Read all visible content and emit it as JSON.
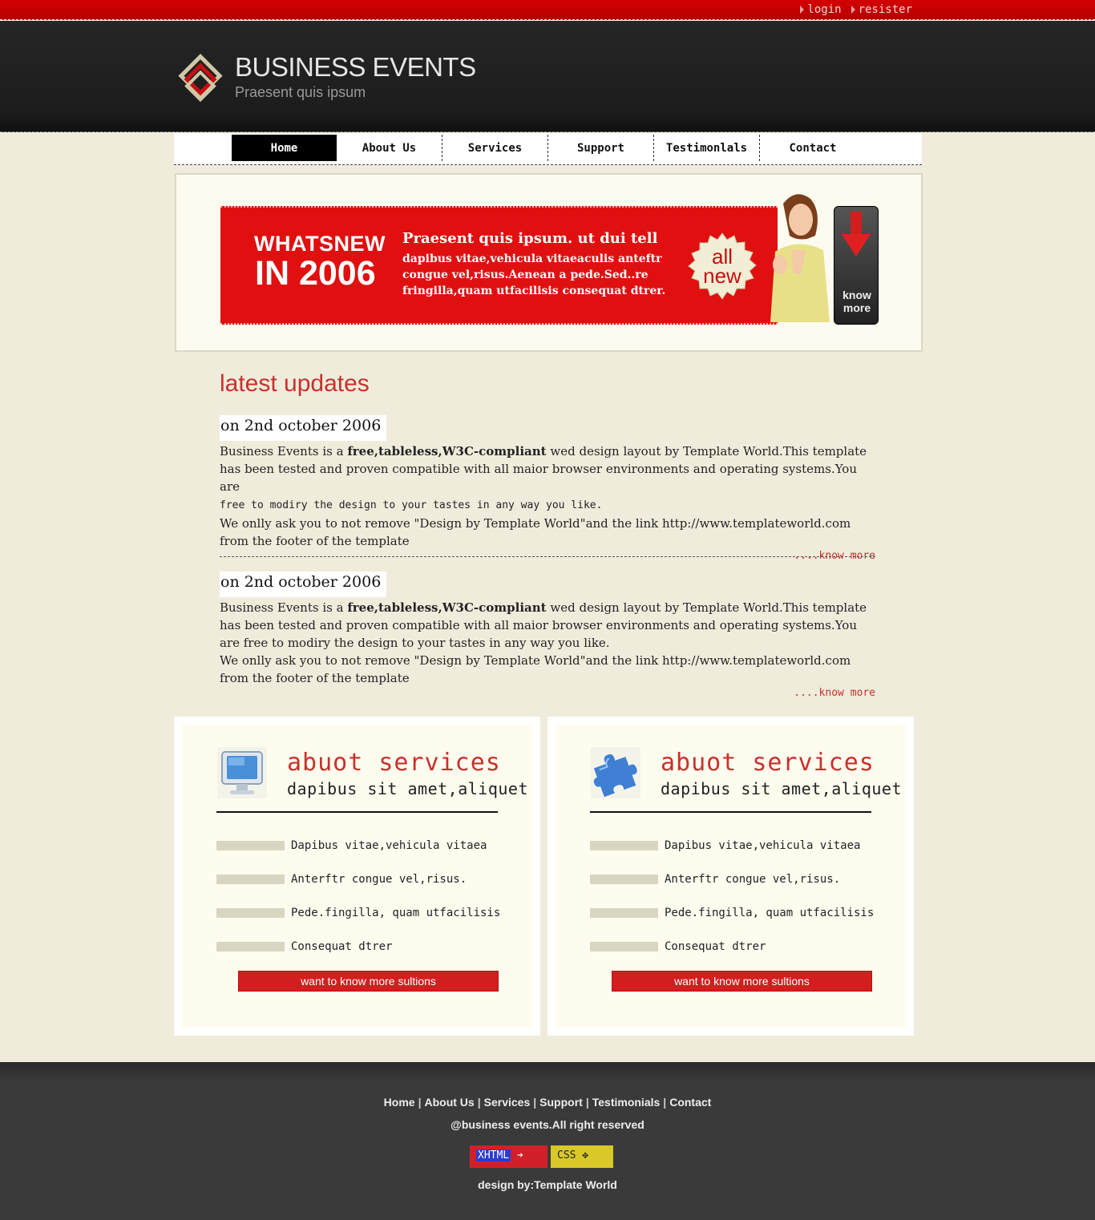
{
  "top_links": {
    "login": "login",
    "register": "resister"
  },
  "header": {
    "title": "BUSINESS EVENTS",
    "subtitle": "Praesent quis ipsum"
  },
  "nav": {
    "home": "Home",
    "about": "About Us",
    "services": "Services",
    "support": "Support",
    "testimonials": "Testimonlals",
    "contact": "Contact"
  },
  "banner": {
    "whatsnew": "WHATSNEW",
    "year": "IN 2006",
    "heading": "Praesent quis ipsum. ut dui tell",
    "text": "dapibus vitae,vehicula vitaeaculis anteftr congue vel,risus.Aenean a pede.Sed..re fringilla,quam utfacilisis consequat dtrer.",
    "badge_line1": "all",
    "badge_line2": "new",
    "know_more_line1": "know",
    "know_more_line2": "more"
  },
  "updates": {
    "title": "latest updates",
    "posts": [
      {
        "date": "on 2nd october 2006",
        "intro": "Business Events is a ",
        "bold": "free,tableless,W3C-compliant",
        "rest": " wed design layout by Template World.This template has been tested and proven compatible with all maior browser environments and operating systems.You are ",
        "rest2": "free to modiry the design to your tastes in any way you like.",
        "para2": "We onlly ask you to not remove \"Design by Template World\"and the link http://www.templateworld.com from the footer of the template",
        "more": "....know more"
      },
      {
        "date": "on 2nd october 2006",
        "intro": "Business Events is a ",
        "bold": "free,tableless,W3C-compliant",
        "rest": " wed design layout by Template World.This template has been tested and proven compatible with all maior browser environments and operating systems.You are free to modiry the design to your tastes in any way you like.",
        "para2": "We onlly ask you to not remove \"Design by Template World\"and the link http://www.templateworld.com from the footer of the template",
        "more": "....know more"
      }
    ]
  },
  "services": [
    {
      "icon": "computer-monitor-icon",
      "title": "abuot services",
      "subtitle": "dapibus sit amet,aliquet",
      "items": [
        "Dapibus vitae,vehicula vitaea",
        "Anterftr congue vel,risus.",
        "Pede.fingilla, quam utfacilisis",
        "Consequat dtrer"
      ],
      "button": "want to know more sultions"
    },
    {
      "icon": "puzzle-piece-icon",
      "title": "abuot services",
      "subtitle": "dapibus sit amet,aliquet",
      "items": [
        "Dapibus vitae,vehicula vitaea",
        "Anterftr congue vel,risus.",
        "Pede.fingilla, quam utfacilisis",
        "Consequat dtrer"
      ],
      "button": "want to know more sultions"
    }
  ],
  "footer": {
    "links": [
      "Home",
      "About Us",
      "Services",
      "Support",
      "Testimonials",
      "Contact"
    ],
    "copyright": "@business events.All right reserved",
    "badge_xhtml": "XHTML",
    "badge_css": "CSS",
    "design": "design by:Template World"
  },
  "colors": {
    "accent_red": "#d40000",
    "heading_red": "#c9302c",
    "header_dark": "#1c1c1c",
    "page_bg": "#f0ecdc"
  }
}
